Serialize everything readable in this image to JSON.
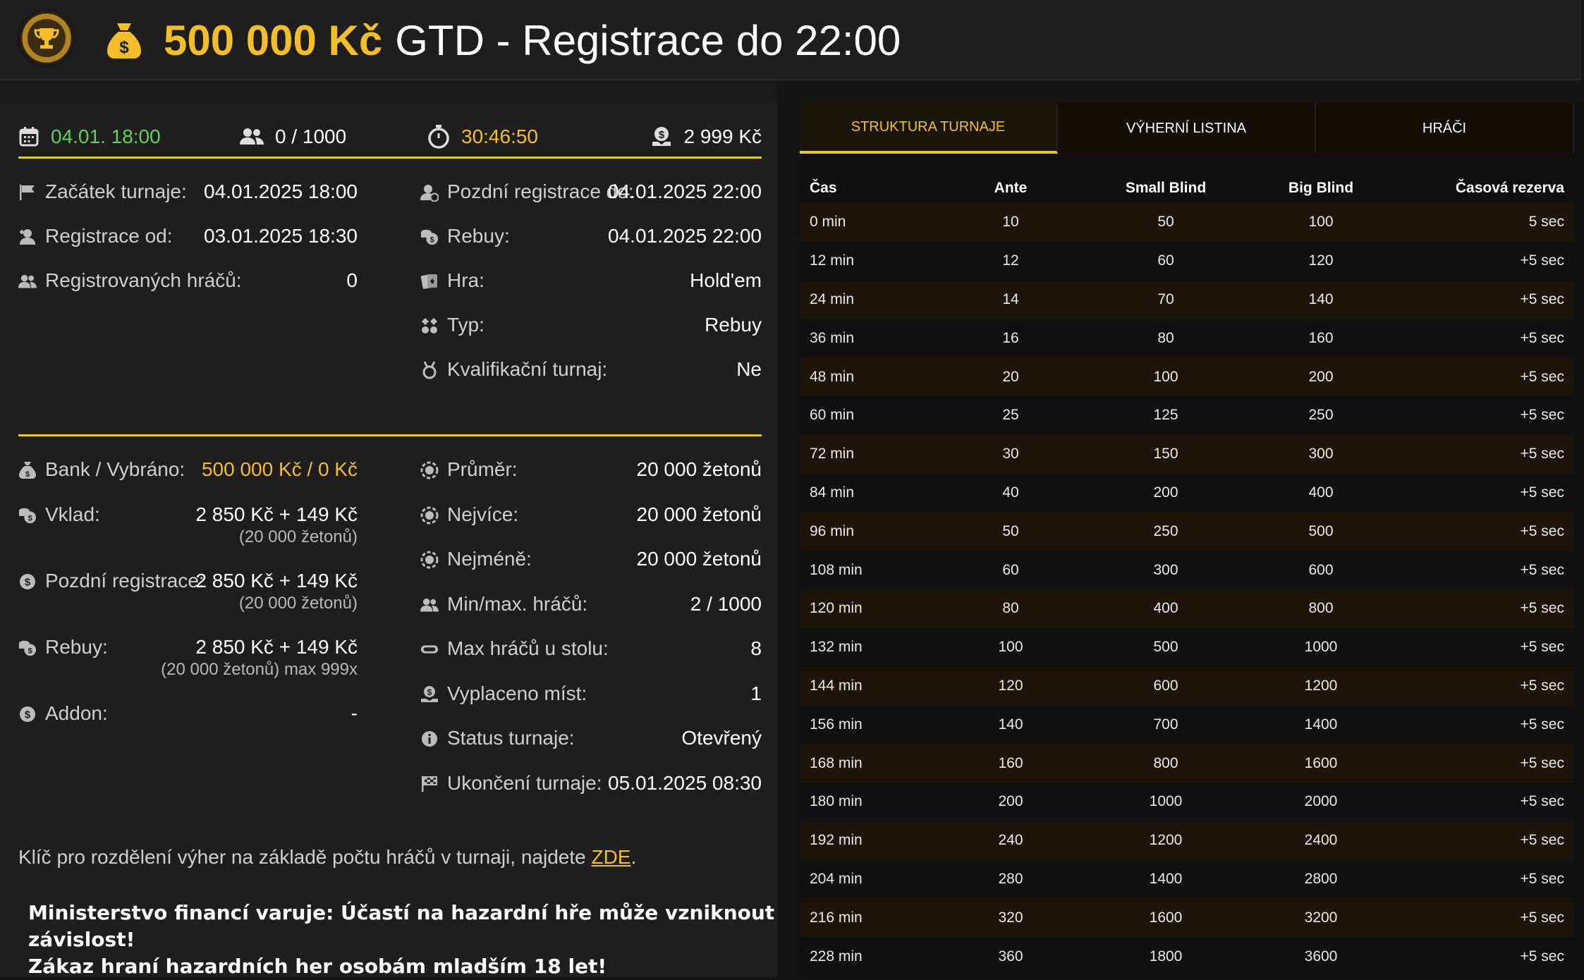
{
  "header": {
    "amount": "500 000 Kč",
    "title_rest": "GTD - Registrace do 22:00"
  },
  "topbar": {
    "date": "04.01. 18:00",
    "players": "0 / 1000",
    "countdown": "30:46:50",
    "buyin": "2 999 Kč"
  },
  "info_left": [
    {
      "label": "Začátek turnaje:",
      "value": "04.01.2025 18:00",
      "icon": "flag-icon"
    },
    {
      "label": "Registrace od:",
      "value": "03.01.2025 18:30",
      "icon": "user-add-icon"
    },
    {
      "label": "Registrovaných hráčů:",
      "value": "0",
      "icon": "users-icon"
    }
  ],
  "info_right": [
    {
      "label": "Pozdní registrace do:",
      "value": "04.01.2025 22:00",
      "icon": "user-clock-icon"
    },
    {
      "label": "Rebuy:",
      "value": "04.01.2025 22:00",
      "icon": "coins-icon"
    },
    {
      "label": "Hra:",
      "value": "Hold'em",
      "icon": "cards-icon"
    },
    {
      "label": "Typ:",
      "value": "Rebuy",
      "icon": "suits-icon"
    },
    {
      "label": "Kvalifikační turnaj:",
      "value": "Ne",
      "icon": "medal-icon"
    }
  ],
  "money_left": [
    {
      "label": "Bank / Vybráno:",
      "value": "500 000 Kč / 0 Kč",
      "sub": "",
      "icon": "moneybag-icon"
    },
    {
      "label": "Vklad:",
      "value": "2 850 Kč + 149 Kč",
      "sub": "(20 000 žetonů)",
      "icon": "coins-icon"
    },
    {
      "label": "Pozdní registrace:",
      "value": "2 850 Kč + 149 Kč",
      "sub": "(20 000 žetonů)",
      "icon": "dollar-coin-icon"
    },
    {
      "label": "Rebuy:",
      "value": "2 850 Kč + 149 Kč",
      "sub": "(20 000 žetonů) max 999x",
      "icon": "coins-icon"
    },
    {
      "label": "Addon:",
      "value": "-",
      "sub": "",
      "icon": "dollar-coin-icon"
    }
  ],
  "money_right": [
    {
      "label": "Průměr:",
      "value": "20 000 žetonů",
      "icon": "chip-icon"
    },
    {
      "label": "Nejvíce:",
      "value": "20 000 žetonů",
      "icon": "chip-icon"
    },
    {
      "label": "Nejméně:",
      "value": "20 000 žetonů",
      "icon": "chip-icon"
    },
    {
      "label": "Min/max. hráčů:",
      "value": "2 / 1000",
      "icon": "users-icon"
    },
    {
      "label": "Max hráčů u stolu:",
      "value": "8",
      "icon": "table-icon"
    },
    {
      "label": "Vyplaceno míst:",
      "value": "1",
      "icon": "payout-icon"
    },
    {
      "label": "Status turnaje:",
      "value": "Otevřený",
      "icon": "info-icon"
    },
    {
      "label": "Ukončení turnaje:",
      "value": "05.01.2025 08:30",
      "icon": "checkered-flag-icon"
    }
  ],
  "keynote": {
    "text": "Klíč pro rozdělení výher na základě počtu hráčů v turnaji, najdete ",
    "link": "ZDE",
    "end": "."
  },
  "warning": {
    "line1": "Ministerstvo financí varuje: Účastí na hazardní hře může vzniknout závislost!",
    "line2": "Zákaz hraní hazardních her osobám mladším 18 let!"
  },
  "tabs": [
    "STRUKTURA TURNAJE",
    "VÝHERNÍ LISTINA",
    "HRÁČI"
  ],
  "structure": {
    "headers": [
      "Čas",
      "Ante",
      "Small Blind",
      "Big Blind",
      "Časová rezerva"
    ],
    "rows": [
      [
        "0 min",
        "10",
        "50",
        "100",
        "5 sec"
      ],
      [
        "12 min",
        "12",
        "60",
        "120",
        "+5 sec"
      ],
      [
        "24 min",
        "14",
        "70",
        "140",
        "+5 sec"
      ],
      [
        "36 min",
        "16",
        "80",
        "160",
        "+5 sec"
      ],
      [
        "48 min",
        "20",
        "100",
        "200",
        "+5 sec"
      ],
      [
        "60 min",
        "25",
        "125",
        "250",
        "+5 sec"
      ],
      [
        "72 min",
        "30",
        "150",
        "300",
        "+5 sec"
      ],
      [
        "84 min",
        "40",
        "200",
        "400",
        "+5 sec"
      ],
      [
        "96 min",
        "50",
        "250",
        "500",
        "+5 sec"
      ],
      [
        "108 min",
        "60",
        "300",
        "600",
        "+5 sec"
      ],
      [
        "120 min",
        "80",
        "400",
        "800",
        "+5 sec"
      ],
      [
        "132 min",
        "100",
        "500",
        "1000",
        "+5 sec"
      ],
      [
        "144 min",
        "120",
        "600",
        "1200",
        "+5 sec"
      ],
      [
        "156 min",
        "140",
        "700",
        "1400",
        "+5 sec"
      ],
      [
        "168 min",
        "160",
        "800",
        "1600",
        "+5 sec"
      ],
      [
        "180 min",
        "200",
        "1000",
        "2000",
        "+5 sec"
      ],
      [
        "192 min",
        "240",
        "1200",
        "2400",
        "+5 sec"
      ],
      [
        "204 min",
        "280",
        "1400",
        "2800",
        "+5 sec"
      ],
      [
        "216 min",
        "320",
        "1600",
        "3200",
        "+5 sec"
      ],
      [
        "228 min",
        "360",
        "1800",
        "3600",
        "+5 sec"
      ]
    ]
  },
  "colors": {
    "accent": "#f5bd27",
    "green": "#5ed35a",
    "panel": "#1e1e1e"
  }
}
